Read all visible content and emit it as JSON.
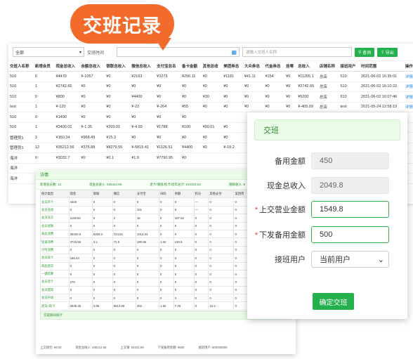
{
  "callout": {
    "title": "交班记录"
  },
  "filters": {
    "store": "全部",
    "time_label": "交班时间",
    "search_placeholder": "请输入交班人名称",
    "query": "查询",
    "export": "导出"
  },
  "table": {
    "headers": [
      "交班人名称",
      "新增会员",
      "现金总收入",
      "余额总收入",
      "银联总收入",
      "微信总收入",
      "支付宝总名",
      "备卡金额",
      "其他总收",
      "美团券总",
      "大众券总",
      "代金券总",
      "挂零",
      "总收入",
      "店铺名称",
      "接班用户",
      "时间范围",
      "操作"
    ],
    "rows": [
      [
        "510",
        "6",
        "¥4470",
        "¥-1057",
        "¥0",
        "¥2163",
        "¥3273",
        "¥256.11",
        "¥0",
        "¥1181",
        "¥41.11",
        "¥154",
        "¥0",
        "¥11205.1",
        "总店",
        "510",
        "2021-06-02 16:35:01",
        "详情 打"
      ],
      [
        "510",
        "1",
        "¥2742.65",
        "¥0",
        "¥0",
        "¥0",
        "¥0",
        "¥0",
        "¥0",
        "¥0",
        "¥0",
        "¥0",
        "¥0",
        "¥2742.65",
        "总店",
        "510",
        "2021-06-02 16:10:22",
        "详情 打"
      ],
      [
        "510",
        "0",
        "¥800",
        "¥0",
        "¥0",
        "¥4400",
        "¥0",
        "¥0",
        "¥30",
        "¥0",
        "¥0",
        "¥0",
        "¥0",
        "¥5200",
        "总店",
        "510",
        "2021-06-02 16:07:46",
        "详情 打"
      ],
      [
        "test",
        "1",
        "¥-120",
        "¥0",
        "¥0",
        "¥-22",
        "¥-264",
        "¥55",
        "¥0",
        "¥0",
        "¥0",
        "¥0",
        "¥0",
        "¥-405.09",
        "总店",
        "test",
        "2021-05-24 12:58:19",
        "详情 打"
      ],
      [
        "510",
        "0",
        "¥1490",
        "¥0",
        "¥0",
        "¥0",
        "¥0",
        "¥0",
        "",
        "",
        "",
        "",
        "",
        "",
        "",
        "",
        "",
        ""
      ],
      [
        "510",
        "1",
        "¥2400.01",
        "¥-1.35",
        "¥200.01",
        "¥-4.99",
        "¥1788",
        "¥100",
        "¥90.01",
        "¥0",
        "",
        "",
        "",
        "",
        "",
        "",
        "",
        ""
      ],
      [
        "管理员1",
        "3",
        "¥150.34",
        "¥968.49",
        "¥15.3",
        "¥0",
        "¥0",
        "¥0",
        "¥0",
        "¥0",
        "",
        "",
        "",
        "",
        "",
        "",
        "",
        ""
      ],
      [
        "管理员1",
        "12",
        "¥35212.56",
        "¥375.88",
        "¥8279.55",
        "¥-5815.41",
        "¥1126.51",
        "¥4400",
        "¥0",
        "¥-18.2",
        "",
        "",
        "",
        "",
        "",
        "",
        "",
        ""
      ],
      [
        "海洋",
        "0",
        "¥3032.7",
        "¥0",
        "¥0.1",
        "¥1.9",
        "¥7790.95",
        "¥0",
        "",
        "",
        "",
        "",
        "",
        "",
        "",
        "",
        "",
        ""
      ],
      [
        "海洋",
        "",
        "",
        "",
        "",
        "",
        "",
        "",
        "",
        "",
        "",
        "",
        "",
        "",
        "",
        "",
        "",
        ""
      ],
      [
        "海洋",
        "",
        "",
        "",
        "",
        "",
        "",
        "",
        "",
        "",
        "",
        "",
        "",
        "",
        "",
        "",
        "",
        ""
      ]
    ]
  },
  "detail": {
    "title": "详情",
    "summary": [
      "新增会员数: 12",
      "现金总收入: ¥35424.56",
      "退卡/储值/续卡/续年总计: ¥10103.62",
      "银联收入: ¥"
    ],
    "headers": [
      "统计类型",
      "现金",
      "银联",
      "微信",
      "支付宝",
      "扫码",
      "余额",
      "积分",
      "其他支付",
      "美团券",
      "大众券",
      "代金"
    ],
    "rows": [
      [
        "会员开卡",
        "4400",
        "0",
        "0",
        "0",
        "0",
        "0",
        "—",
        "0",
        "0",
        "0",
        "0"
      ],
      [
        "会员充值",
        "0",
        "0",
        "0",
        "101",
        "0",
        "0",
        "—",
        "0",
        "0",
        "0",
        "0"
      ],
      [
        "会员充次",
        "1159.92",
        "0",
        "2",
        "16",
        "0",
        "167.63",
        "0",
        "0",
        "0",
        "0",
        "0"
      ],
      [
        "会员退款",
        "0",
        "0",
        "0",
        "0",
        "0",
        "0",
        "0",
        "0",
        "0",
        "0",
        "0"
      ],
      [
        "商品消费",
        "26420.5",
        "6280.3",
        "724.04",
        "1013.03",
        "0",
        "0",
        "0",
        "0",
        "0",
        "0",
        "0"
      ],
      [
        "快速消费",
        "3715.56",
        "3.1",
        "72.5",
        "190.95",
        "1.02",
        "130.5",
        "0",
        "0",
        "0",
        "0",
        "63.55"
      ],
      [
        "计时消费",
        "0",
        "0",
        "0",
        "0",
        "0",
        "0",
        "0",
        "0",
        "0",
        "0",
        "0"
      ],
      [
        "会员续卡",
        "165.43",
        "0",
        "0",
        "0",
        "0",
        "0",
        "0",
        "0",
        "0",
        "0",
        "0"
      ],
      [
        "商品退货",
        "0",
        "0",
        "0",
        "0",
        "0",
        "0",
        "0",
        "0",
        "0",
        "0",
        "0"
      ],
      [
        "一键结算",
        "0",
        "0",
        "0",
        "0",
        "0",
        "0",
        "0",
        "0",
        "0",
        "0",
        "0"
      ],
      [
        "会员退卡",
        "270",
        "0",
        "0",
        "0",
        "0",
        "0",
        "0",
        "0",
        "0",
        "0",
        "0"
      ],
      [
        "会员提现",
        "0",
        "0",
        "0",
        "0",
        "0",
        "0",
        "0",
        "0",
        "0",
        "0",
        "0"
      ],
      [
        "会员升级",
        "0",
        "0",
        "0",
        "0",
        "0",
        "0",
        "0",
        "0",
        "0",
        "0",
        "0"
      ],
      [
        "退货+取卡",
        "2636.36",
        "3.85",
        "6613.96",
        "262",
        "1.52",
        "7.26",
        "0",
        "10.2",
        "0",
        "0",
        "0"
      ]
    ],
    "bar": "交班期间统计",
    "footer": [
      "上交钱宝: ¥0.00",
      "现金总收入: ¥35212.56",
      "上交银: ¥3421.56",
      "下发备用金额: ¥500",
      "接班用户: ¥00000000"
    ]
  },
  "modal": {
    "title": "交班",
    "reserve_label": "备用金额",
    "reserve_value": "450",
    "cash_label": "现金总收入",
    "cash_value": "2049.8",
    "handin_label": "上交营业金额",
    "handin_value": "1549.8",
    "issue_label": "下发备用金额",
    "issue_value": "500",
    "successor_label": "接班用户",
    "successor_value": "当前用户",
    "confirm": "确定交班"
  }
}
